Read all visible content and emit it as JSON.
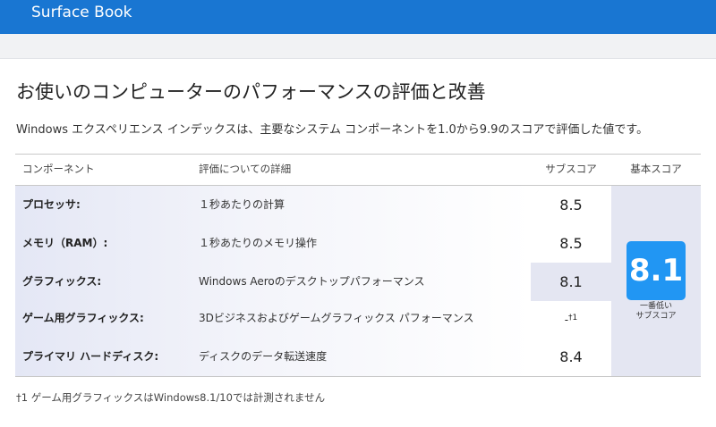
{
  "app": {
    "title": "Surface Book"
  },
  "page": {
    "title": "お使いのコンピューターのパフォーマンスの評価と改善",
    "description": "Windows エクスペリエンス インデックスは、主要なシステム コンポーネントを1.0から9.9のスコアで評価した値です。"
  },
  "table": {
    "headers": {
      "component": "コンポーネント",
      "detail": "評価についての詳細",
      "subscore": "サブスコア",
      "base": "基本スコア"
    },
    "rows": [
      {
        "component": "プロセッサ:",
        "detail": "１秒あたりの計算",
        "score": "8.5"
      },
      {
        "component": "メモリ（RAM）:",
        "detail": "１秒あたりのメモリ操作",
        "score": "8.5"
      },
      {
        "component": "グラフィックス:",
        "detail": "Windows Aeroのデスクトップパフォーマンス",
        "score": "8.1"
      },
      {
        "component": "ゲーム用グラフィックス:",
        "detail": "3Dビジネスおよびゲームグラフィックス パフォーマンス",
        "score": "-",
        "mark": "†1"
      },
      {
        "component": "プライマリ ハードディスク:",
        "detail": "ディスクのデータ転送速度",
        "score": "8.4"
      }
    ],
    "base_score": "8.1",
    "base_caption_line1": "一番低い",
    "base_caption_line2": "サブスコア"
  },
  "footnote": "†1 ゲーム用グラフィックスはWindows8.1/10では計測されません",
  "colors": {
    "topbar": "#1976d2",
    "badge": "#2196f3",
    "highlight": "#e4e6f2"
  }
}
